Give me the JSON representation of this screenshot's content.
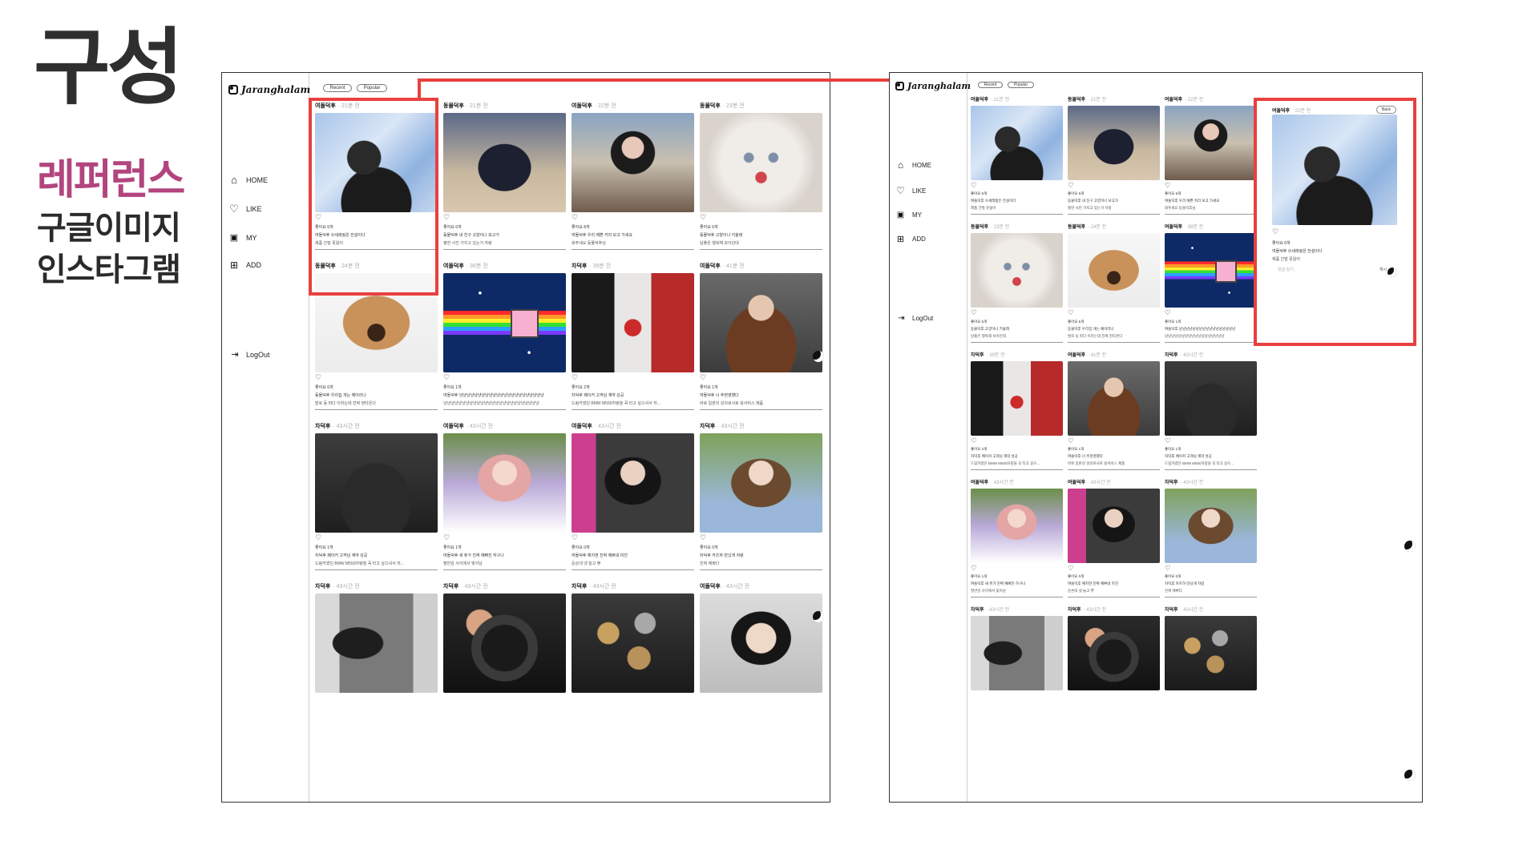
{
  "slide": {
    "title": "구성",
    "reference_heading": "레퍼런스",
    "reference_items": [
      "구글이미지",
      "인스타그램"
    ]
  },
  "app": {
    "logo_text": "Jaranghalam",
    "nav": [
      {
        "label": "HOME",
        "icon": "home-icon"
      },
      {
        "label": "LIKE",
        "icon": "heart-icon"
      },
      {
        "label": "MY",
        "icon": "profile-icon"
      },
      {
        "label": "ADD",
        "icon": "add-icon"
      }
    ],
    "logout": "LogOut",
    "sort_tabs": [
      "Recent",
      "Popular"
    ],
    "back_label": "Back"
  },
  "left_posts": [
    {
      "author": "여돌덕후",
      "time": "· 21분 전",
      "photo": "p-sparkle",
      "likes": "좋아요 6개",
      "title": "여돌덕후 쓰세래됨은 전설이다",
      "caption": "제품 간발 못잃어"
    },
    {
      "author": "동물덕후",
      "time": "· 21분 전",
      "photo": "p-blackcat",
      "likes": "좋아요 6개",
      "title": "동물덕후 내 친구 고양이나 보고가",
      "caption": "평한 사진 가지고 있는거 자랑"
    },
    {
      "author": "여돌덕후",
      "time": "· 22분 전",
      "photo": "p-girl-tree",
      "likes": "좋아요 8개",
      "title": "여돌덕후 우리 예쁜 카리 보고 가세요",
      "caption": "화푸세요 동물덕후님"
    },
    {
      "author": "동물덕후",
      "time": "· 23분 전",
      "photo": "p-whitecat",
      "likes": "좋아요 6개",
      "title": "동물덕후 고양이나 키울래",
      "caption": "날풀은 행복해 보이던데"
    },
    {
      "author": "동물덕후",
      "time": "· 24분 전",
      "photo": "p-dog",
      "likes": "좋아요 6개",
      "title": "동물덕후 우리집 개는 예어라나",
      "caption": "발로 동 따다 이러는데 진짜 현타온다"
    },
    {
      "author": "여돌덕후",
      "time": "· 38분 전",
      "photo": "p-nyan",
      "likes": "좋아요 1개",
      "title": "여돌덕후 냥냥냥냥냥냥냥냥냥냥냥냥냥냥냥냥냥냥냥냥냥냥냥",
      "caption": "냥냥냥냥냥냥냥냥냥냥냥냥냥냥냥냥냥냥냥냥냥냥냥냥냥냥"
    },
    {
      "author": "차덕후",
      "time": "· 39분 전",
      "photo": "p-handshake",
      "likes": "좋아요 2개",
      "title": "차덕후 페이커 고객님 계약 성공",
      "caption": "드림카였던 BMW M550차량을 꼭 타고 싶으셔서 저..."
    },
    {
      "author": "여돌덕후",
      "time": "· 41분 전",
      "photo": "p-woman-brown",
      "likes": "좋아요 1개",
      "title": "여돌덕후 너 주현영했다",
      "caption": "바로 일본의 성의로사로 왕서비스 제품"
    },
    {
      "author": "차덕후",
      "time": "· 43시간 전",
      "photo": "p-car",
      "likes": "좋아요 1개",
      "title": "차덕후 페이커 고객님 계약 성공",
      "caption": "드림카였던 BMW M550차량을 꼭 타고 싶으셔서 저..."
    },
    {
      "author": "여돌덕후",
      "time": "· 43시간 전",
      "photo": "p-pinkgirl",
      "likes": "좋아요 1개",
      "title": "여돌덕후 새 츄가 진짜 예뻐진 하구나",
      "caption": "팔반감 사이에서 빛이남"
    },
    {
      "author": "여돌덕후",
      "time": "· 43시간 전",
      "photo": "p-darkgirl",
      "likes": "좋아요 0개",
      "title": "여돌덕후 예지현 진짜 예쁘네 미친",
      "caption": "운손대 넷 늘고 쀼"
    },
    {
      "author": "차덕후",
      "time": "· 43시간 전",
      "photo": "p-bluegirl",
      "likes": "좋아요 0개",
      "title": "차덕후 카즈하 만났게 자랑",
      "caption": "진짜 예쁘다"
    },
    {
      "author": "차덕후",
      "time": "· 43시간 전",
      "photo": "p-coat"
    },
    {
      "author": "차덕후",
      "time": "· 43시간 전",
      "photo": "p-wheel"
    },
    {
      "author": "차덕후",
      "time": "· 43시간 전",
      "photo": "p-watches"
    },
    {
      "author": "여돌덕후",
      "time": "· 43시간 전",
      "photo": "p-iu"
    }
  ],
  "right_posts": [
    {
      "author": "여돌덕후",
      "time": "· 21분 전",
      "photo": "p-sparkle",
      "likes": "좋아요 6개",
      "title": "여돌덕후 쓰세래됨은 전설이다",
      "caption": "제품 간발 못잃어"
    },
    {
      "author": "동물덕후",
      "time": "· 21분 전",
      "photo": "p-blackcat",
      "likes": "좋아요 6개",
      "title": "동물덕후 내 친구 고양이나 보고가",
      "caption": "평한 사진 가지고 있는거 자랑"
    },
    {
      "author": "여돌덕후",
      "time": "· 22분 전",
      "photo": "p-girl-tree",
      "likes": "좋아요 6개",
      "title": "여돌덕후 우리 예쁜 카리 보고 가세요",
      "caption": "화푸세요 동물덕후님"
    },
    {
      "author": "동물덕후",
      "time": "· 23분 전",
      "photo": "p-whitecat",
      "likes": "좋아요 6개",
      "title": "동물덕후 고양이나 키울래",
      "caption": "날풀은 행복해 보이던데"
    },
    {
      "author": "동물덕후",
      "time": "· 24분 전",
      "photo": "p-dog",
      "likes": "좋아요 6개",
      "title": "동물덕후 우리집 개는 예어라나",
      "caption": "발로 동 따다 이러는데 진짜 현타온다"
    },
    {
      "author": "여돌덕후",
      "time": "· 38분 전",
      "photo": "p-nyan",
      "likes": "좋아요 1개",
      "title": "여돌덕후 냥냥냥냥냥냥냥냥냥냥냥냥냥냥냥냥냥",
      "caption": "냥냥냥냥냥냥냥냥냥냥냥냥냥냥냥냥냥냥"
    },
    {
      "author": "차덕후",
      "time": "· 39분 전",
      "photo": "p-handshake",
      "likes": "좋아요 2개",
      "title": "차덕후 페이커 고객님 계약 성공",
      "caption": "드림카였던 BMW M550차량을 꼭 타고 싶으..."
    },
    {
      "author": "여돌덕후",
      "time": "· 41분 전",
      "photo": "p-woman-brown",
      "likes": "좋아요 1개",
      "title": "여돌덕후 너 주현영했다",
      "caption": "바로 일본의 성의로사로 왕서비스 제품"
    },
    {
      "author": "차덕후",
      "time": "· 43시간 전",
      "photo": "p-car",
      "likes": "좋아요 1개",
      "title": "차덕후 페이커 고객님 계약 성공",
      "caption": "드림카였던 BMW M550차량을 꼭 타고 싶으..."
    },
    {
      "author": "여돌덕후",
      "time": "· 43시간 전",
      "photo": "p-pinkgirl",
      "likes": "좋아요 1개",
      "title": "여돌덕후 새 츄가 진짜 예뻐진 하구나",
      "caption": "팔반감 사이에서 빛이남"
    },
    {
      "author": "여돌덕후",
      "time": "· 43시간 전",
      "photo": "p-darkgirl",
      "likes": "좋아요 0개",
      "title": "여돌덕후 예지현 진짜 예쁘네 미친",
      "caption": "운손대 넷 늘고 쀼"
    },
    {
      "author": "차덕후",
      "time": "· 43시간 전",
      "photo": "p-bluegirl",
      "likes": "좋아요 0개",
      "title": "차덕후 카즈하 만났게 자랑",
      "caption": "진짜 예쁘다"
    },
    {
      "author": "차덕후",
      "time": "· 43시간 전",
      "photo": "p-coat"
    },
    {
      "author": "차덕후",
      "time": "· 43시간 전",
      "photo": "p-wheel"
    },
    {
      "author": "차덕후",
      "time": "· 43시간 전",
      "photo": "p-watches"
    }
  ],
  "detail": {
    "author": "여돌덕후",
    "time": "· 21분 전",
    "photo": "p-sparkle",
    "likes": "좋아요 6개",
    "title": "여돌덕후 쓰세래됨은 전설이다",
    "caption": "제품 간발 못잃어",
    "comment_placeholder": "댓글 달기...",
    "post_label": "게시"
  },
  "colors": {
    "highlight_red": "#e8403f",
    "reference_pink": "#b2457e"
  }
}
